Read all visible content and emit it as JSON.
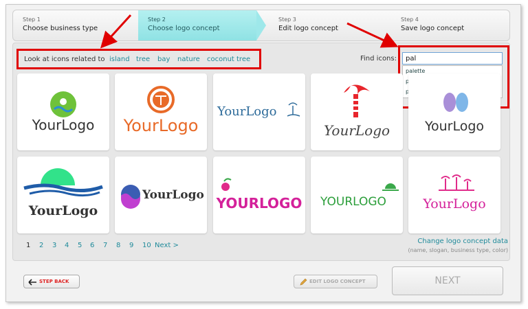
{
  "steps": [
    {
      "num": "Step 1",
      "title": "Choose business type"
    },
    {
      "num": "Step 2",
      "title": "Choose logo concept"
    },
    {
      "num": "Step 3",
      "title": "Edit logo concept"
    },
    {
      "num": "Step 4",
      "title": "Save logo concept"
    }
  ],
  "related": {
    "label": "Look at icons related to",
    "tags": [
      "island",
      "tree",
      "bay",
      "nature",
      "coconut tree"
    ]
  },
  "find": {
    "label": "Find icons:",
    "value": "pal",
    "suggestions": [
      "palette",
      "palm",
      "palmtree"
    ]
  },
  "logos": {
    "text": [
      "YourLogo",
      "YourLogo",
      "YourLogo",
      "YourLogo",
      "YourLogo",
      "YourLogo",
      "YourLogo",
      "YOURLOGO",
      "YOURLOGO",
      "YourLogo"
    ]
  },
  "pager": {
    "pages": [
      "1",
      "2",
      "3",
      "4",
      "5",
      "6",
      "7",
      "8",
      "9",
      "10"
    ],
    "current": "1",
    "next": "Next >"
  },
  "change": {
    "link": "Change logo concept data",
    "sub": "(name, slogan, business type, color)"
  },
  "buttons": {
    "back": "STEP BACK",
    "edit": "EDIT LOGO CONCEPT",
    "next": "NEXT"
  },
  "colors": {
    "accent": "#1f8a9a",
    "annotation": "#e00000",
    "active_step": "#9ee8ea"
  }
}
